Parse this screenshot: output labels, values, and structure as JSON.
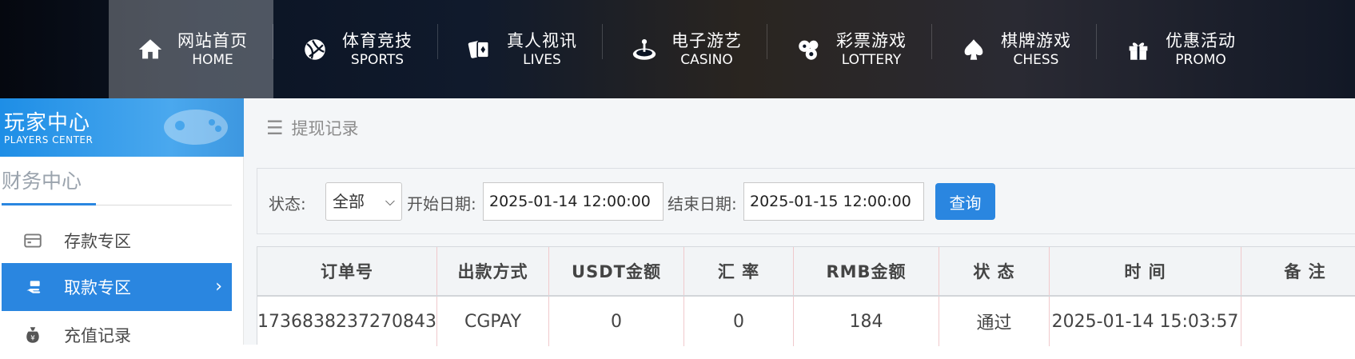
{
  "nav": {
    "items": [
      {
        "cn": "网站首页",
        "en": "HOME",
        "icon": "home-icon",
        "active": true
      },
      {
        "cn": "体育竞技",
        "en": "SPORTS",
        "icon": "ball-icon"
      },
      {
        "cn": "真人视讯",
        "en": "LIVES",
        "icon": "cards-icon"
      },
      {
        "cn": "电子游艺",
        "en": "CASINO",
        "icon": "slot-icon"
      },
      {
        "cn": "彩票游戏",
        "en": "LOTTERY",
        "icon": "lottery-balls-icon"
      },
      {
        "cn": "棋牌游戏",
        "en": "CHESS",
        "icon": "spade-icon"
      },
      {
        "cn": "优惠活动",
        "en": "PROMO",
        "icon": "gift-icon"
      }
    ]
  },
  "sidebar": {
    "title_cn": "玩家中心",
    "title_en": "PLAYERS CENTER",
    "section": "财务中心",
    "items": [
      {
        "label": "存款专区",
        "icon": "deposit-icon"
      },
      {
        "label": "取款专区",
        "icon": "withdraw-icon",
        "active": true
      },
      {
        "label": "充值记录",
        "icon": "moneybag-icon"
      }
    ]
  },
  "main": {
    "breadcrumb": "提现记录",
    "filter": {
      "status_label": "状态:",
      "status_value": "全部",
      "start_label": "开始日期:",
      "start_value": "2025-01-14 12:00:00",
      "end_label": "结束日期:",
      "end_value": "2025-01-15 12:00:00",
      "query_label": "查询"
    },
    "table": {
      "headers": [
        "订单号",
        "出款方式",
        "USDT金额",
        "汇 率",
        "RMB金额",
        "状 态",
        "时 间",
        "备 注"
      ],
      "rows": [
        [
          "1736838237270843",
          "CGPAY",
          "0",
          "0",
          "184",
          "通过",
          "2025-01-14 15:03:57",
          ""
        ]
      ]
    }
  },
  "colors": {
    "accent": "#2a86e0",
    "nav_bg": "#0b1424"
  }
}
